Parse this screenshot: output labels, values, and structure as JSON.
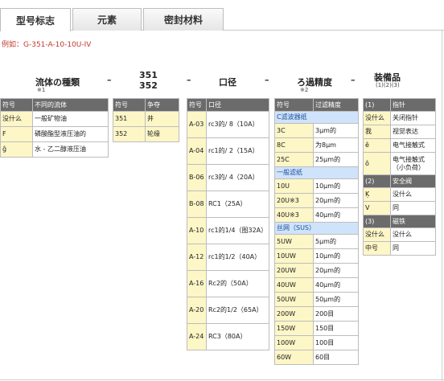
{
  "tabs": [
    "型号标志",
    "元素",
    "密封材料"
  ],
  "example": "例如：G-351-A-10-10U-IV",
  "headers": {
    "fluid": "流体の種類",
    "fluid_note": "※1",
    "model_a": "351",
    "model_b": "352",
    "port": "口径",
    "filter": "ろ過精度",
    "filter_note": "※2",
    "equip": "装備品",
    "equip_note": "(1)(2)(3)",
    "dash": "–"
  },
  "fluid_table": {
    "head": [
      "符号",
      "不同的流体"
    ],
    "rows": [
      [
        "没什么",
        "一般矿物油"
      ],
      [
        "F",
        "磷酸酯型液压油的"
      ],
      [
        "ĝ",
        "水 - 乙二醇液压油"
      ]
    ]
  },
  "model_table": {
    "head": [
      "符号",
      "争夺"
    ],
    "rows": [
      [
        "351",
        "井"
      ],
      [
        "352",
        "轮缘"
      ]
    ]
  },
  "port_table": {
    "head": [
      "符号",
      "口径"
    ],
    "rows": [
      [
        "A-03",
        "rc3的/ 8（10A）"
      ],
      [
        "A-04",
        "rc1的/ 2（15A）"
      ],
      [
        "B-06",
        "rc3的/ 4（20A）"
      ],
      [
        "B-08",
        "RC1（25A）"
      ],
      [
        "A-10",
        "rc1的1/4（图32A）"
      ],
      [
        "A-12",
        "rc1的1/2（40A）"
      ],
      [
        "A-16",
        "Rc2的（50A）"
      ],
      [
        "A-20",
        "Rc2的1/2（65A）"
      ],
      [
        "A-24",
        "RC3（80A）"
      ]
    ]
  },
  "filter_table": {
    "head": [
      "符号",
      "过滤精度"
    ],
    "groups": [
      {
        "title": "C滤波器纸",
        "rows": [
          [
            "3C",
            "3μm的"
          ],
          [
            "8C",
            "为8μm"
          ],
          [
            "25C",
            "25μm的"
          ]
        ]
      },
      {
        "title": "一般滤纸",
        "rows": [
          [
            "10U",
            "10μm的"
          ],
          [
            "20U※3",
            "20μm的"
          ],
          [
            "40U※3",
            "40μm的"
          ]
        ]
      },
      {
        "title": "丝网（SUS）",
        "rows": [
          [
            "5UW",
            "5μm的"
          ],
          [
            "10UW",
            "10μm的"
          ],
          [
            "20UW",
            "20μm的"
          ],
          [
            "40UW",
            "40μm的"
          ],
          [
            "50UW",
            "50μm的"
          ],
          [
            "200W",
            "200目"
          ],
          [
            "150W",
            "150目"
          ],
          [
            "100W",
            "100目"
          ],
          [
            "60W",
            "60目"
          ]
        ]
      }
    ]
  },
  "equip_table": {
    "sections": [
      {
        "code": "(1)",
        "title": "指针",
        "rows": [
          [
            "没什么",
            "关闭指针"
          ],
          [
            "我",
            "视觉表达"
          ],
          [
            "ê",
            "电气接触式"
          ],
          [
            "ô",
            "电气接触式（小负荷）"
          ]
        ]
      },
      {
        "code": "(2)",
        "title": "安全阀",
        "rows": [
          [
            "Ķ",
            "没什么"
          ],
          [
            "V",
            "同"
          ]
        ]
      },
      {
        "code": "(3)",
        "title": "磁铁",
        "rows": [
          [
            "没什么",
            "没什么"
          ],
          [
            "中号",
            "同"
          ]
        ]
      }
    ]
  }
}
